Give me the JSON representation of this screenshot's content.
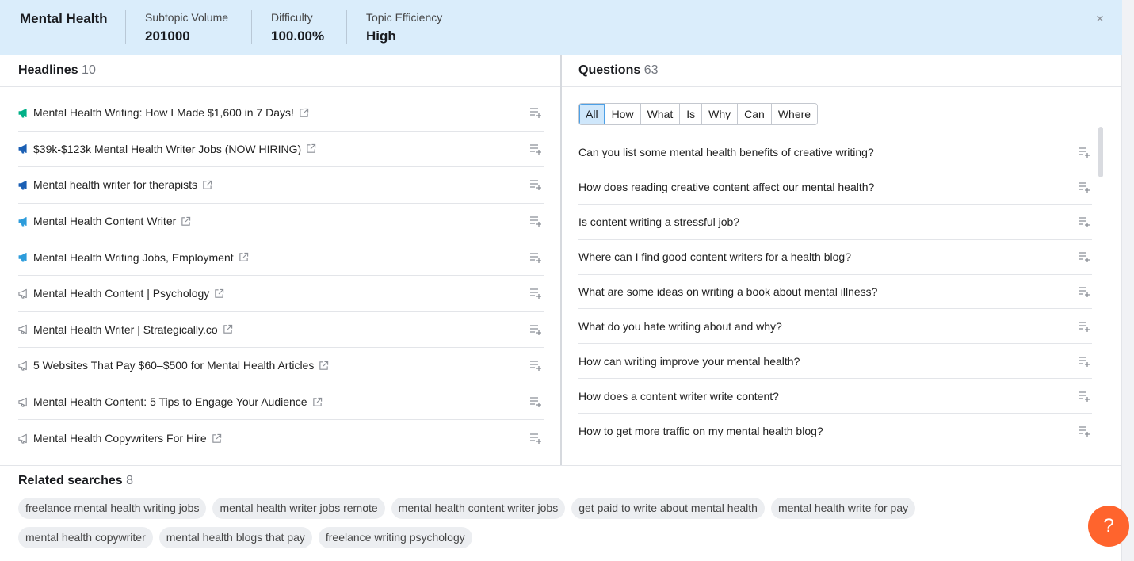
{
  "topbar": {
    "topic": "Mental Health",
    "metrics": [
      {
        "label": "Subtopic Volume",
        "value": "201000"
      },
      {
        "label": "Difficulty",
        "value": "100.00%"
      },
      {
        "label": "Topic Efficiency",
        "value": "High"
      }
    ],
    "close_icon": "×"
  },
  "headlines": {
    "title": "Headlines",
    "count": "10",
    "items": [
      {
        "text": "Mental Health Writing: How I Made $1,600 in 7 Days!",
        "icon_color": "#00b087"
      },
      {
        "text": "$39k-$123k Mental Health Writer Jobs (NOW HIRING)",
        "icon_color": "#1a5fb4"
      },
      {
        "text": "Mental health writer for therapists",
        "icon_color": "#1a5fb4"
      },
      {
        "text": "Mental Health Content Writer",
        "icon_color": "#2d9cdb"
      },
      {
        "text": "Mental Health Writing Jobs, Employment",
        "icon_color": "#2d9cdb"
      },
      {
        "text": "Mental Health Content | Psychology",
        "icon_color": "outline"
      },
      {
        "text": "Mental Health Writer | Strategically.co",
        "icon_color": "outline"
      },
      {
        "text": "5 Websites That Pay $60–$500 for Mental Health Articles",
        "icon_color": "outline"
      },
      {
        "text": "Mental Health Content: 5 Tips to Engage Your Audience",
        "icon_color": "outline"
      },
      {
        "text": "Mental Health Copywriters For Hire",
        "icon_color": "outline"
      }
    ]
  },
  "questions": {
    "title": "Questions",
    "count": "63",
    "tabs": [
      "All",
      "How",
      "What",
      "Is",
      "Why",
      "Can",
      "Where"
    ],
    "active_tab": "All",
    "items": [
      "Can you list some mental health benefits of creative writing?",
      "How does reading creative content affect our mental health?",
      "Is content writing a stressful job?",
      "Where can I find good content writers for a health blog?",
      "What are some ideas on writing a book about mental illness?",
      "What do you hate writing about and why?",
      "How can writing improve your mental health?",
      "How does a content writer write content?",
      "How to get more traffic on my mental health blog?"
    ]
  },
  "related": {
    "title": "Related searches",
    "count": "8",
    "rows": [
      [
        "freelance mental health writing jobs",
        "mental health writer jobs remote",
        "mental health content writer jobs",
        "get paid to write about mental health",
        "mental health write for pay"
      ],
      [
        "mental health copywriter",
        "mental health blogs that pay",
        "freelance writing psychology"
      ]
    ]
  },
  "help": {
    "label": "?"
  },
  "colors": {
    "accent": "#ff642d",
    "topbar": "#daedfb",
    "active_tab": "#cfe7fb"
  }
}
